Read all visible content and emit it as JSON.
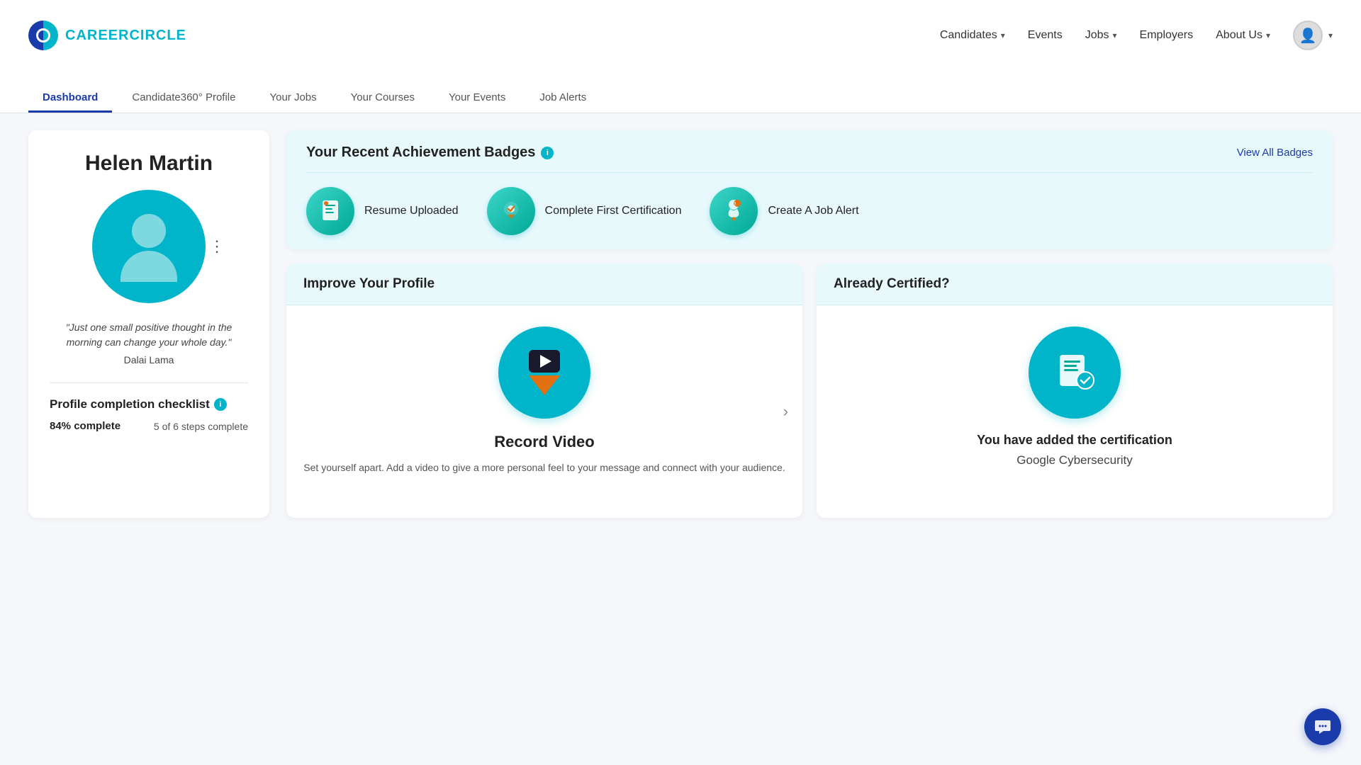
{
  "logo": {
    "text_career": "CAREER",
    "text_circle": "CIRCLE"
  },
  "nav": {
    "candidates": "Candidates",
    "events": "Events",
    "jobs": "Jobs",
    "employers": "Employers",
    "about_us": "About Us"
  },
  "tabs": [
    {
      "label": "Dashboard",
      "active": true
    },
    {
      "label": "Candidate360° Profile",
      "active": false
    },
    {
      "label": "Your Jobs",
      "active": false
    },
    {
      "label": "Your Courses",
      "active": false
    },
    {
      "label": "Your Events",
      "active": false
    },
    {
      "label": "Job Alerts",
      "active": false
    }
  ],
  "user": {
    "name": "Helen Martin",
    "quote": "\"Just one small positive thought in the morning can change your whole day.\"",
    "quote_author": "Dalai Lama"
  },
  "checklist": {
    "title": "Profile completion checklist",
    "percent": "84% complete",
    "steps": "5 of 6 steps complete"
  },
  "badges": {
    "title": "Your Recent Achievement Badges",
    "view_all": "View All Badges",
    "items": [
      {
        "label": "Resume Uploaded",
        "icon": "📄"
      },
      {
        "label": "Complete First Certification",
        "icon": "📍"
      },
      {
        "label": "Create A Job Alert",
        "icon": "🔔"
      }
    ]
  },
  "improve": {
    "header": "Improve Your Profile",
    "card_title": "Record Video",
    "card_desc": "Set yourself apart. Add a video to give a more personal feel to your message and connect with your audience."
  },
  "certified": {
    "header": "Already Certified?",
    "desc": "You have added the certification",
    "cert_name": "Google Cybersecurity"
  }
}
